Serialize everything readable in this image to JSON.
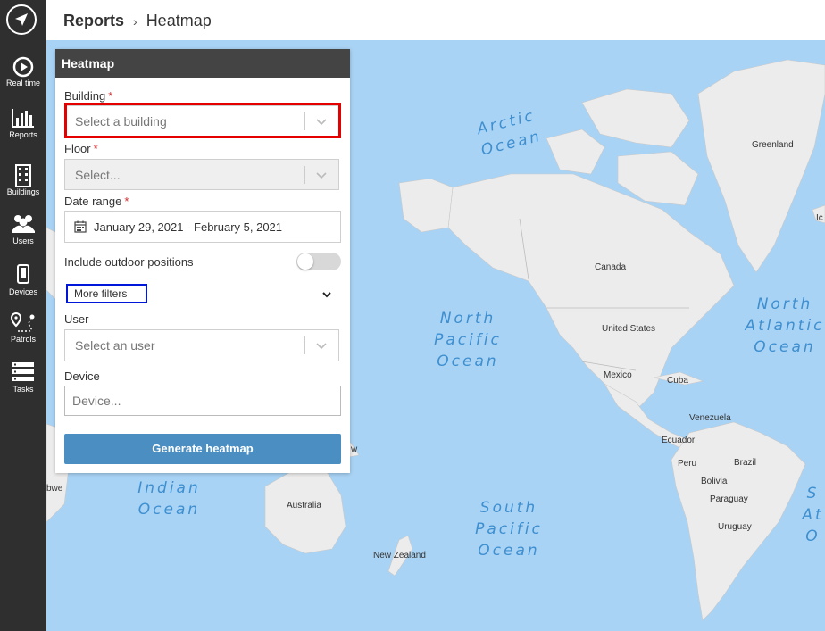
{
  "sidebar": {
    "logo_icon": "navigation-arrow-icon",
    "items": [
      {
        "label": "Real time",
        "icon": "play-circle-icon"
      },
      {
        "label": "Reports",
        "icon": "bar-chart-icon"
      },
      {
        "label": "Buildings",
        "icon": "building-icon"
      },
      {
        "label": "Users",
        "icon": "users-icon"
      },
      {
        "label": "Devices",
        "icon": "phone-icon"
      },
      {
        "label": "Patrols",
        "icon": "route-icon"
      },
      {
        "label": "Tasks",
        "icon": "tasks-icon"
      }
    ]
  },
  "header": {
    "breadcrumb": [
      "Reports",
      "Heatmap"
    ],
    "separator": "›"
  },
  "panel": {
    "title": "Heatmap",
    "building_label": "Building",
    "building_placeholder": "Select a building",
    "floor_label": "Floor",
    "floor_placeholder": "Select...",
    "required_mark": "*",
    "date_label": "Date range",
    "date_value": "January 29, 2021 - February 5, 2021",
    "outdoor_label": "Include outdoor positions",
    "outdoor_enabled": false,
    "more_filters_label": "More filters",
    "user_label": "User",
    "user_placeholder": "Select an user",
    "device_label": "Device",
    "device_placeholder": "Device...",
    "generate_label": "Generate heatmap"
  },
  "map": {
    "oceans": {
      "arctic": "Arctic Ocean",
      "north_pacific": "North Pacific Ocean",
      "north_atlantic": "North Atlantic Ocean",
      "indian": "Indian Ocean",
      "south_pacific": "South Pacific Ocean",
      "south_atlantic": "S At O"
    },
    "countries": {
      "greenland": "Greenland",
      "canada": "Canada",
      "united_states": "United States",
      "mexico": "Mexico",
      "cuba": "Cuba",
      "venezuela": "Venezuela",
      "ecuador": "Ecuador",
      "peru": "Peru",
      "brazil": "Brazil",
      "bolivia": "Bolivia",
      "paraguay": "Paraguay",
      "uruguay": "Uruguay",
      "australia": "Australia",
      "new_zealand": "New Zealand",
      "iceland_partial": "Ic",
      "png_partial": "w",
      "zimbabwe_partial": "bwe"
    }
  },
  "colors": {
    "sidebar": "#2f2f2f",
    "ocean": "#a9d3f5",
    "land": "#ececec",
    "button": "#4a8ec2",
    "highlight_red": "#e50000",
    "highlight_blue": "#0016d8"
  }
}
